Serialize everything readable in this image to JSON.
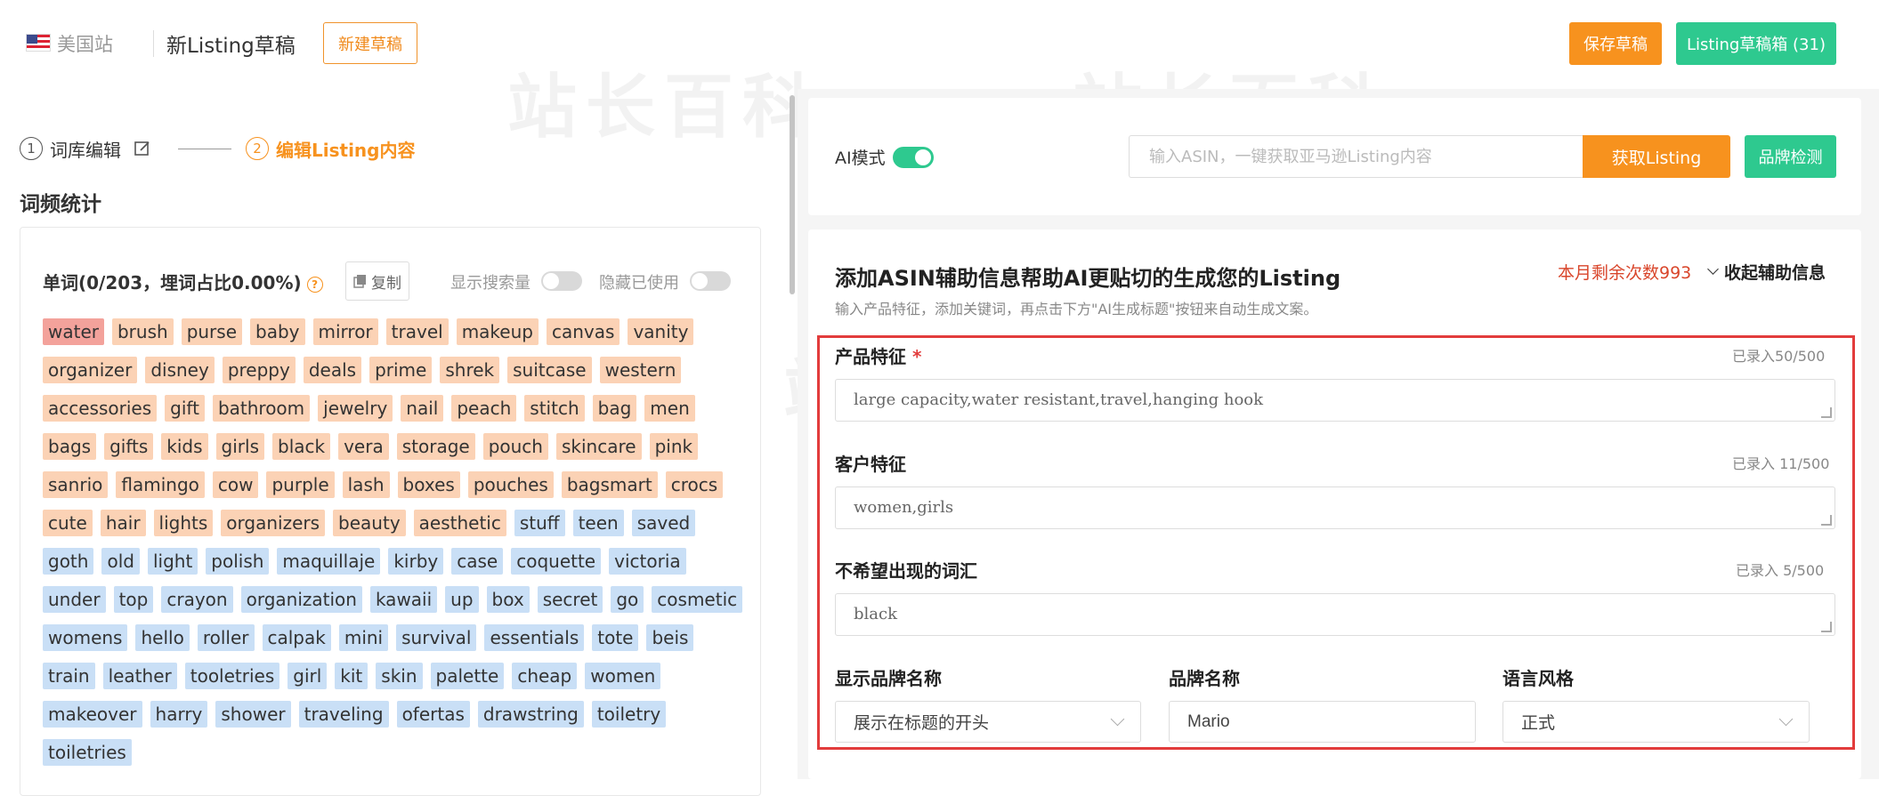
{
  "header": {
    "site": "美国站",
    "draft_title": "新Listing草稿",
    "new_draft": "新建草稿",
    "save_draft": "保存草稿",
    "draft_box": "Listing草稿箱 (31)"
  },
  "steps": [
    {
      "num": "1",
      "label": "词库编辑"
    },
    {
      "num": "2",
      "label": "编辑Listing内容"
    }
  ],
  "left": {
    "section_title": "词频统计",
    "word_head": "单词(0/203，埋词占比0.00%)",
    "help": "?",
    "copy": "复制",
    "show_search": "显示搜索量",
    "hide_used": "隐藏已使用",
    "tags": [
      {
        "w": "water",
        "c": "red"
      },
      {
        "w": "brush",
        "c": "org"
      },
      {
        "w": "purse",
        "c": "org"
      },
      {
        "w": "baby",
        "c": "org"
      },
      {
        "w": "mirror",
        "c": "org"
      },
      {
        "w": "travel",
        "c": "org"
      },
      {
        "w": "makeup",
        "c": "org"
      },
      {
        "w": "canvas",
        "c": "org"
      },
      {
        "w": "vanity",
        "c": "org"
      },
      {
        "w": "organizer",
        "c": "org"
      },
      {
        "w": "disney",
        "c": "org"
      },
      {
        "w": "preppy",
        "c": "org"
      },
      {
        "w": "deals",
        "c": "org"
      },
      {
        "w": "prime",
        "c": "org"
      },
      {
        "w": "shrek",
        "c": "org"
      },
      {
        "w": "suitcase",
        "c": "org"
      },
      {
        "w": "western",
        "c": "org"
      },
      {
        "w": "accessories",
        "c": "org"
      },
      {
        "w": "gift",
        "c": "org"
      },
      {
        "w": "bathroom",
        "c": "org"
      },
      {
        "w": "jewelry",
        "c": "org"
      },
      {
        "w": "nail",
        "c": "org"
      },
      {
        "w": "peach",
        "c": "org"
      },
      {
        "w": "stitch",
        "c": "org"
      },
      {
        "w": "bag",
        "c": "org"
      },
      {
        "w": "men",
        "c": "org"
      },
      {
        "w": "bags",
        "c": "org"
      },
      {
        "w": "gifts",
        "c": "org"
      },
      {
        "w": "kids",
        "c": "org"
      },
      {
        "w": "girls",
        "c": "org"
      },
      {
        "w": "black",
        "c": "org"
      },
      {
        "w": "vera",
        "c": "org"
      },
      {
        "w": "storage",
        "c": "org"
      },
      {
        "w": "pouch",
        "c": "org"
      },
      {
        "w": "skincare",
        "c": "org"
      },
      {
        "w": "pink",
        "c": "org"
      },
      {
        "w": "sanrio",
        "c": "org"
      },
      {
        "w": "flamingo",
        "c": "org"
      },
      {
        "w": "cow",
        "c": "org"
      },
      {
        "w": "purple",
        "c": "org"
      },
      {
        "w": "lash",
        "c": "org"
      },
      {
        "w": "boxes",
        "c": "org"
      },
      {
        "w": "pouches",
        "c": "org"
      },
      {
        "w": "bagsmart",
        "c": "org"
      },
      {
        "w": "crocs",
        "c": "org"
      },
      {
        "w": "cute",
        "c": "org"
      },
      {
        "w": "hair",
        "c": "org"
      },
      {
        "w": "lights",
        "c": "org"
      },
      {
        "w": "organizers",
        "c": "org"
      },
      {
        "w": "beauty",
        "c": "org"
      },
      {
        "w": "aesthetic",
        "c": "org"
      },
      {
        "w": "stuff",
        "c": "blu"
      },
      {
        "w": "teen",
        "c": "blu"
      },
      {
        "w": "saved",
        "c": "blu"
      },
      {
        "w": "goth",
        "c": "blu"
      },
      {
        "w": "old",
        "c": "blu"
      },
      {
        "w": "light",
        "c": "blu"
      },
      {
        "w": "polish",
        "c": "blu"
      },
      {
        "w": "maquillaje",
        "c": "blu"
      },
      {
        "w": "kirby",
        "c": "blu"
      },
      {
        "w": "case",
        "c": "blu"
      },
      {
        "w": "coquette",
        "c": "blu"
      },
      {
        "w": "victoria",
        "c": "blu"
      },
      {
        "w": "under",
        "c": "blu"
      },
      {
        "w": "top",
        "c": "blu"
      },
      {
        "w": "crayon",
        "c": "blu"
      },
      {
        "w": "organization",
        "c": "blu"
      },
      {
        "w": "kawaii",
        "c": "blu"
      },
      {
        "w": "up",
        "c": "blu"
      },
      {
        "w": "box",
        "c": "blu"
      },
      {
        "w": "secret",
        "c": "blu"
      },
      {
        "w": "go",
        "c": "blu"
      },
      {
        "w": "cosmetic",
        "c": "blu"
      },
      {
        "w": "womens",
        "c": "blu"
      },
      {
        "w": "hello",
        "c": "blu"
      },
      {
        "w": "roller",
        "c": "blu"
      },
      {
        "w": "calpak",
        "c": "blu"
      },
      {
        "w": "mini",
        "c": "blu"
      },
      {
        "w": "survival",
        "c": "blu"
      },
      {
        "w": "essentials",
        "c": "blu"
      },
      {
        "w": "tote",
        "c": "blu"
      },
      {
        "w": "beis",
        "c": "blu"
      },
      {
        "w": "train",
        "c": "blu"
      },
      {
        "w": "leather",
        "c": "blu"
      },
      {
        "w": "tooletries",
        "c": "blu"
      },
      {
        "w": "girl",
        "c": "blu"
      },
      {
        "w": "kit",
        "c": "blu"
      },
      {
        "w": "skin",
        "c": "blu"
      },
      {
        "w": "palette",
        "c": "blu"
      },
      {
        "w": "cheap",
        "c": "blu"
      },
      {
        "w": "women",
        "c": "blu"
      },
      {
        "w": "makeover",
        "c": "blu"
      },
      {
        "w": "harry",
        "c": "blu"
      },
      {
        "w": "shower",
        "c": "blu"
      },
      {
        "w": "traveling",
        "c": "blu"
      },
      {
        "w": "ofertas",
        "c": "blu"
      },
      {
        "w": "drawstring",
        "c": "blu"
      },
      {
        "w": "toiletry",
        "c": "blu"
      },
      {
        "w": "toiletries",
        "c": "blu"
      }
    ]
  },
  "right": {
    "ai_mode": "AI模式",
    "asin_placeholder": "输入ASIN，一键获取亚马逊Listing内容",
    "fetch": "获取Listing",
    "brand_check": "品牌检测",
    "assist_title": "添加ASIN辅助信息帮助AI更贴切的生成您的Listing",
    "assist_sub": "输入产品特征，添加关键词，再点击下方\"AI生成标题\"按钮来自动生成文案。",
    "remaining": "本月剩余次数993",
    "collapse": "收起辅助信息",
    "fields": {
      "product": {
        "label": "产品特征",
        "required": "*",
        "count": "已录入50/500",
        "value": "large capacity,water resistant,travel,hanging hook"
      },
      "customer": {
        "label": "客户特征",
        "count": "已录入 11/500",
        "value": "women,girls"
      },
      "avoid": {
        "label": "不希望出现的词汇",
        "count": "已录入 5/500",
        "value": "black"
      }
    },
    "brand_display": {
      "label": "显示品牌名称",
      "value": "展示在标题的开头"
    },
    "brand_name": {
      "label": "品牌名称",
      "value": "Mario"
    },
    "lang_style": {
      "label": "语言风格",
      "value": "正式"
    }
  },
  "watermark": "站长百科"
}
